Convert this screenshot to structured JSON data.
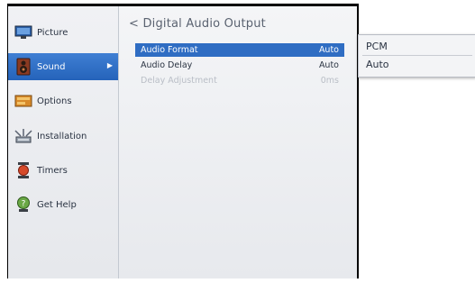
{
  "sidebar": {
    "items": [
      {
        "label": "Picture",
        "icon": "monitor-icon"
      },
      {
        "label": "Sound",
        "icon": "speaker-icon",
        "active": true
      },
      {
        "label": "Options",
        "icon": "options-icon"
      },
      {
        "label": "Installation",
        "icon": "satellite-icon"
      },
      {
        "label": "Timers",
        "icon": "timer-icon"
      },
      {
        "label": "Get Help",
        "icon": "help-icon"
      }
    ],
    "arrow": "▶"
  },
  "main": {
    "back_glyph": "<",
    "title": "Digital Audio Output",
    "rows": [
      {
        "label": "Audio Format",
        "value": "Auto",
        "state": "selected"
      },
      {
        "label": "Audio Delay",
        "value": "Auto",
        "state": "normal"
      },
      {
        "label": "Delay Adjustment",
        "value": "0ms",
        "state": "disabled"
      }
    ]
  },
  "dropdown": {
    "options": [
      "PCM",
      "Auto"
    ]
  },
  "colors": {
    "accent": "#2f6dc3",
    "sidebar_active": "#2563ba"
  }
}
